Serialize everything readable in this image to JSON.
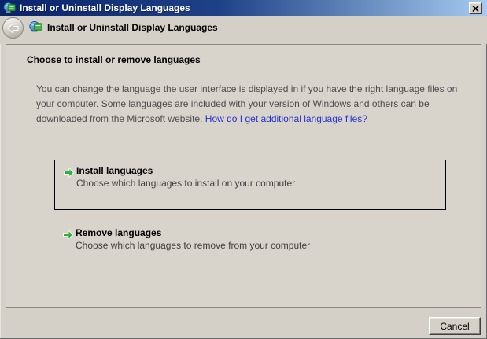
{
  "window": {
    "title": "Install or Uninstall Display Languages"
  },
  "header": {
    "title": "Install or Uninstall Display Languages"
  },
  "content": {
    "heading": "Choose to install or remove languages",
    "body_text": "You can change the language the user interface is displayed in if you have the right language files on your computer. Some languages are included with your version of Windows and others can be downloaded from the Microsoft website. ",
    "link_text": "How do I get additional language files?",
    "options": [
      {
        "title": "Install languages",
        "description": "Choose which languages to install on your computer",
        "focused": true
      },
      {
        "title": "Remove languages",
        "description": "Choose which languages to remove from your computer",
        "focused": false
      }
    ]
  },
  "footer": {
    "cancel_label": "Cancel"
  },
  "icons": {
    "window_icon": "display-languages-globe",
    "back_icon": "back-arrow",
    "close_icon": "close-x",
    "option_icon": "green-right-arrow"
  },
  "colors": {
    "titlebar_gradient_left": "#0a246a",
    "titlebar_gradient_right": "#a6caf0",
    "window_face": "#d4d0c8",
    "panel_face": "#d8d4cc",
    "link_blue": "#2633cc",
    "command_arrow_green": "#2fae3e",
    "focus_border": "#000000"
  }
}
